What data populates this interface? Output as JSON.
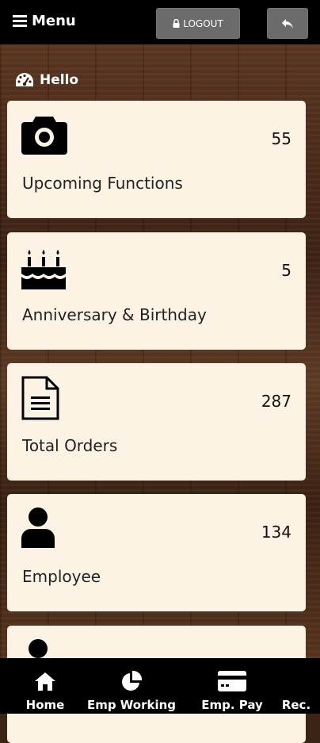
{
  "header": {
    "menu_label": "Menu",
    "logout_label": "LOGOUT"
  },
  "greeting": "Hello",
  "cards": [
    {
      "label": "Upcoming Functions",
      "count": "55",
      "icon": "camera-icon"
    },
    {
      "label": "Anniversary & Birthday",
      "count": "5",
      "icon": "birthday-cake-icon"
    },
    {
      "label": "Total Orders",
      "count": "287",
      "icon": "document-icon"
    },
    {
      "label": "Employee",
      "count": "134",
      "icon": "user-icon"
    }
  ],
  "bottom_nav": [
    {
      "label": "Home",
      "icon": "home-icon"
    },
    {
      "label": "Emp Working",
      "icon": "pie-chart-icon"
    },
    {
      "label": "Emp. Pay",
      "icon": "credit-card-icon"
    },
    {
      "label": "Rec.",
      "icon": "receipt-icon"
    }
  ],
  "colors": {
    "card_bg": "#fdf3e4",
    "topbar_bg": "#000000",
    "button_bg": "#6b6b6b"
  }
}
